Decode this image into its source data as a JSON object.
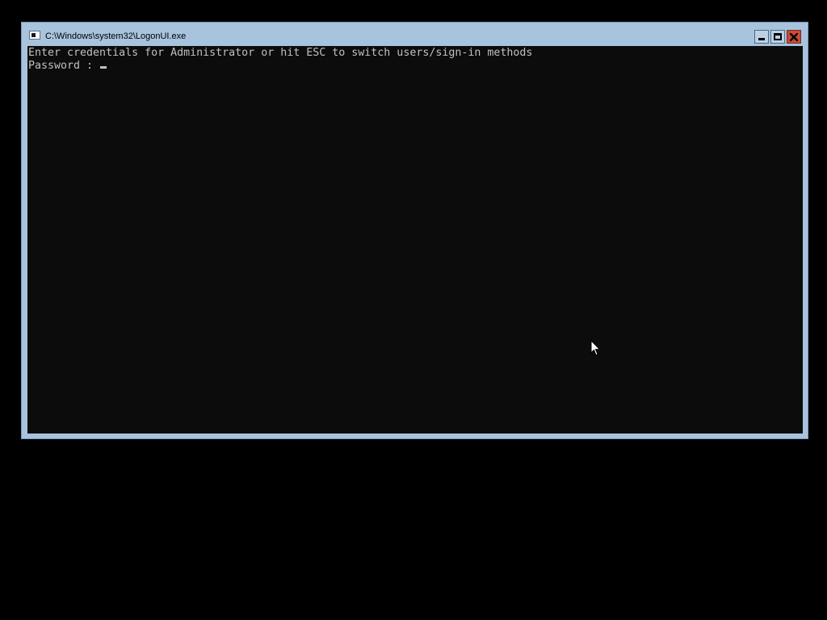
{
  "window": {
    "title": "C:\\Windows\\system32\\LogonUI.exe"
  },
  "console": {
    "prompt_line": "Enter credentials for Administrator or hit ESC to switch users/sign-in methods",
    "password_label": "Password : "
  },
  "icons": {
    "window_icon": "console-window-icon",
    "minimize": "minimize-icon",
    "maximize": "maximize-icon",
    "close": "close-icon",
    "cursor": "mouse-pointer-icon"
  },
  "colors": {
    "desktop_bg": "#000000",
    "titlebar": "#a7c3de",
    "console_bg": "#0c0c0c",
    "console_text": "#c0c0c0",
    "close_button": "#c94b38"
  }
}
